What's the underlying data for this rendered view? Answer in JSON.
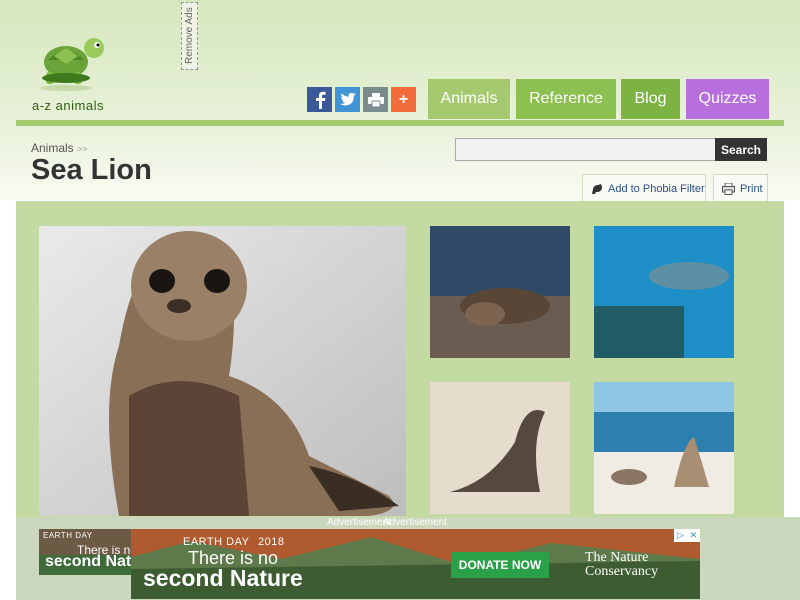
{
  "site": {
    "logo_text": "a-z animals",
    "remove_ads_label": "Remove Ads"
  },
  "share": {
    "facebook_icon": "facebook-icon",
    "twitter_icon": "twitter-icon",
    "print_icon": "print-icon",
    "plus_icon": "plus-icon",
    "plus_glyph": "+"
  },
  "nav": {
    "items": [
      {
        "label": "Animals",
        "color": "#a4c96f"
      },
      {
        "label": "Reference",
        "color": "#8cc152"
      },
      {
        "label": "Blog",
        "color": "#7cb342"
      },
      {
        "label": "Quizzes",
        "color": "#b86fde"
      }
    ]
  },
  "breadcrumb": {
    "root": "Animals",
    "separator": ">>"
  },
  "page": {
    "title": "Sea Lion"
  },
  "search": {
    "value": "",
    "placeholder": "",
    "button_label": "Search"
  },
  "tools": {
    "phobia_label": "Add to Phobia Filter",
    "print_label": "Print"
  },
  "ads": {
    "label_a": "Advertisement",
    "label_b": "Advertisement",
    "eyebrow": "EARTH DAY",
    "year": "2018",
    "line1": "There is no",
    "line2": "second Nature",
    "mini_line1": "There is no",
    "mini_line2": "second Nat",
    "donate_label": "DONATE NOW",
    "brand_line1": "The Nature",
    "brand_line2": "Conservancy"
  },
  "colors": {
    "accent_green": "#a4c96f",
    "gallery_bg": "#c3dba2",
    "quizzes_purple": "#b86fde",
    "donate_green": "#2aa048"
  }
}
